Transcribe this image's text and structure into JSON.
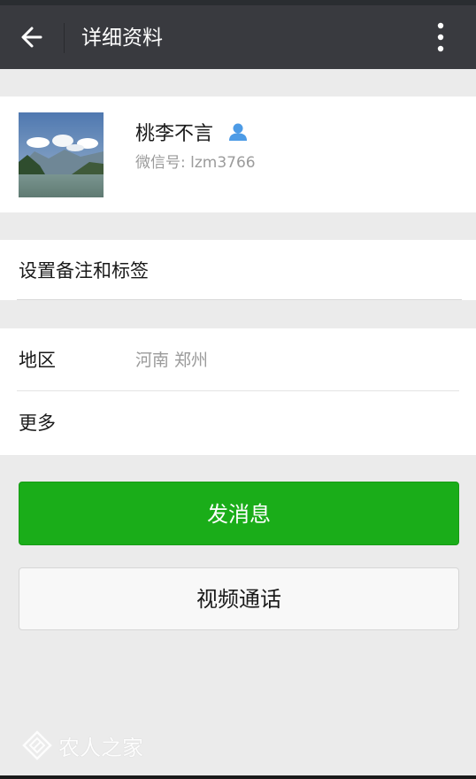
{
  "header": {
    "title": "详细资料",
    "back_icon": "arrow-left-icon",
    "menu_icon": "more-vertical-icon"
  },
  "profile": {
    "name": "桃李不言",
    "wechat_id": "微信号: lzm3766",
    "contact_icon": "contact-person-icon"
  },
  "remark": {
    "label": "设置备注和标签"
  },
  "info": {
    "region_label": "地区",
    "region_value": "河南  郑州",
    "more_label": "更多"
  },
  "actions": {
    "send_message": "发消息",
    "video_call": "视频通话"
  },
  "watermark": {
    "text": "农人之家"
  },
  "colors": {
    "app_bar": "#393a3f",
    "primary_green": "#1aad19",
    "background": "#ebebeb"
  }
}
